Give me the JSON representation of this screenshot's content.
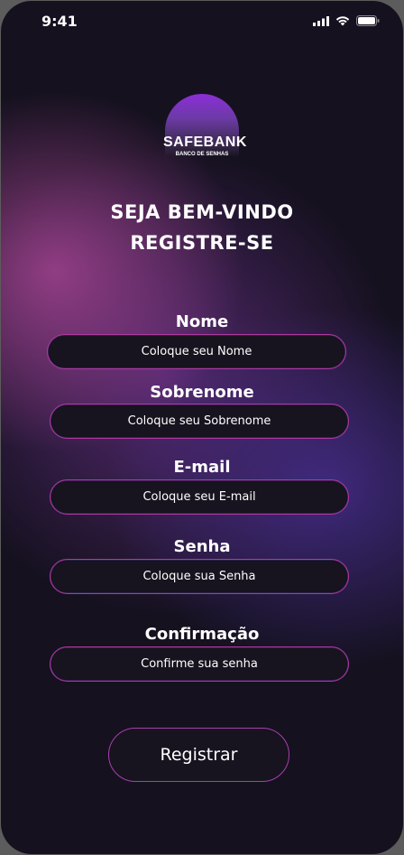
{
  "status": {
    "time": "9:41"
  },
  "logo": {
    "name": "SAFEBANK",
    "subtitle": "BANCO DE SENHAS"
  },
  "heading": {
    "line1": "SEJA BEM-VINDO",
    "line2": "REGISTRE-SE"
  },
  "form": {
    "fields": [
      {
        "label": "Nome",
        "placeholder": "Coloque seu Nome"
      },
      {
        "label": "Sobrenome",
        "placeholder": "Coloque seu Sobrenome"
      },
      {
        "label": "E-mail",
        "placeholder": "Coloque seu E-mail"
      },
      {
        "label": "Senha",
        "placeholder": "Coloque sua Senha"
      },
      {
        "label": "Confirmação",
        "placeholder": "Confirme sua senha"
      }
    ],
    "submit_label": "Registrar"
  },
  "colors": {
    "accent_pink": "#b0389f",
    "accent_purple": "#8b2fd6",
    "background": "#15111f"
  },
  "icons": [
    "signal-icon",
    "wifi-icon",
    "battery-icon"
  ]
}
